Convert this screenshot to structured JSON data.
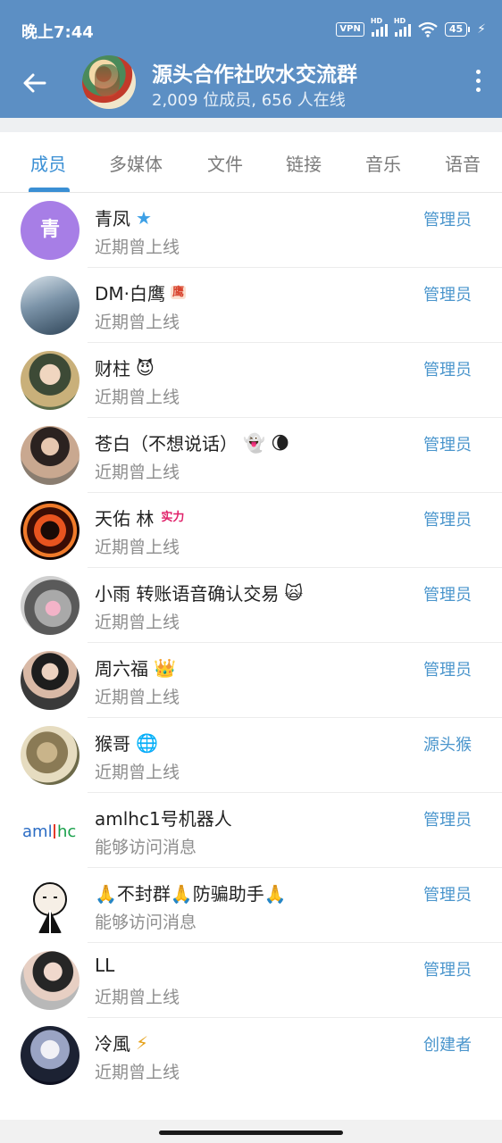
{
  "status_bar": {
    "time": "晚上7:44",
    "vpn": "VPN",
    "hd1": "HD",
    "hd2": "HD",
    "battery": "45",
    "charging": "⚡"
  },
  "header": {
    "title": "源头合作社吹水交流群",
    "subtitle": "2,009 位成员, 656 人在线",
    "back_icon": "arrow-left-icon",
    "more_icon": "more-vertical-icon"
  },
  "tabs": [
    {
      "label": "成员",
      "active": true
    },
    {
      "label": "多媒体",
      "active": false
    },
    {
      "label": "文件",
      "active": false
    },
    {
      "label": "链接",
      "active": false
    },
    {
      "label": "音乐",
      "active": false
    },
    {
      "label": "语音",
      "active": false
    }
  ],
  "members": [
    {
      "name": "青凤",
      "emoji": "★",
      "status": "近期曾上线",
      "role": "管理员",
      "avatar_letter": "青",
      "avatar_color": "#a77ee6"
    },
    {
      "name": "DM·白鹰",
      "emoji": "鹰",
      "status": "近期曾上线",
      "role": "管理员"
    },
    {
      "name": "财柱",
      "emoji": "😈",
      "status": "近期曾上线",
      "role": "管理员"
    },
    {
      "name": "苍白（不想说话）",
      "emoji": "👻 🌘",
      "status": "近期曾上线",
      "role": "管理员"
    },
    {
      "name": "天佑 林",
      "emoji": "实力",
      "status": "近期曾上线",
      "role": "管理员"
    },
    {
      "name": "小雨 转账语音确认交易",
      "emoji": "🙀",
      "status": "近期曾上线",
      "role": "管理员"
    },
    {
      "name": "周六福",
      "emoji": "👑",
      "status": "近期曾上线",
      "role": "管理员"
    },
    {
      "name": "猴哥",
      "emoji": "🌐",
      "status": "近期曾上线",
      "role": "源头猴"
    },
    {
      "name": "amlhc1号机器人",
      "emoji": "",
      "status": "能够访问消息",
      "role": "管理员",
      "avatar_text": "aml hc"
    },
    {
      "name": "🙏不封群🙏防骗助手🙏",
      "emoji": "",
      "status": "能够访问消息",
      "role": "管理员"
    },
    {
      "name": "LL",
      "emoji": "",
      "status": "近期曾上线",
      "role": "管理员"
    },
    {
      "name": "冷風",
      "emoji": "⚡",
      "status": "近期曾上线",
      "role": "创建者"
    }
  ],
  "colors": {
    "header_bg": "#5c8fc4",
    "accent": "#3a8fd4",
    "role_text": "#4a95cc",
    "secondary_text": "#8e8e8e"
  }
}
